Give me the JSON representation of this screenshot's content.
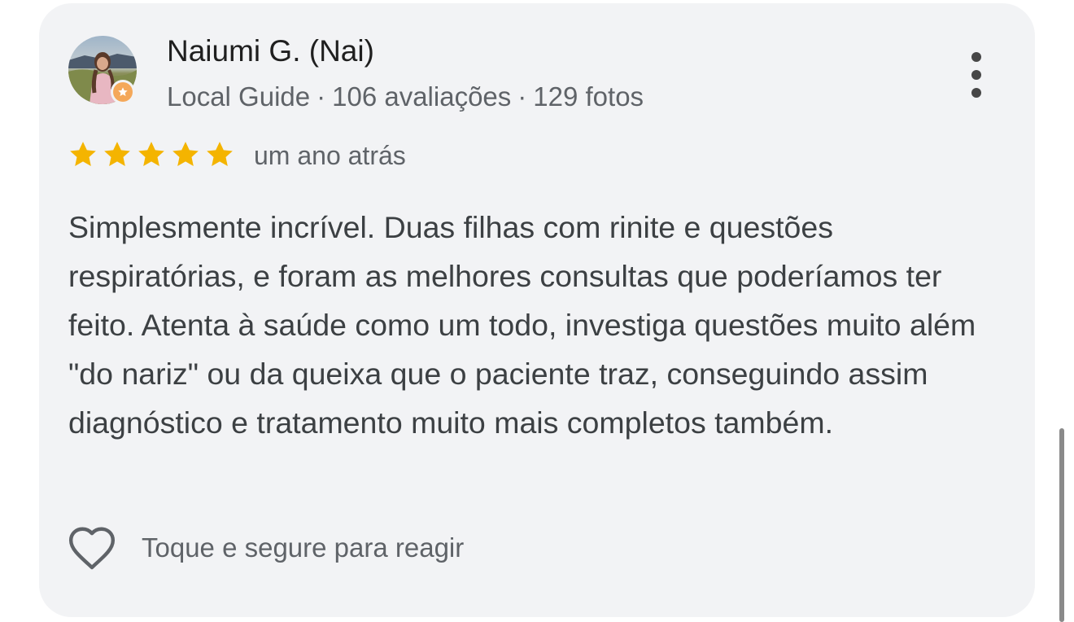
{
  "reviewer": {
    "name": "Naiumi G. (Nai)",
    "badge": "Local Guide",
    "reviews_count": "106 avaliações",
    "photos_count": "129 fotos",
    "separator": "·",
    "avatar_icon": "profile-photo",
    "badge_icon": "star-icon"
  },
  "rating": {
    "stars": 5,
    "max_stars": 5,
    "star_color": "#f4b400",
    "time_ago": "um ano atrás"
  },
  "review_text": "Simplesmente incrível. Duas filhas com rinite e questões respiratórias, e foram as melhores consultas que poderíamos ter feito. Atenta à saúde como um todo, investiga questões muito além \"do nariz\" ou da queixa que o paciente traz, conseguindo assim diagnóstico e tratamento muito mais completos também.",
  "reaction": {
    "icon": "heart-outline-icon",
    "label": "Toque e segure para reagir"
  },
  "menu": {
    "icon": "more-vert-icon"
  },
  "colors": {
    "card_background": "#f2f3f5",
    "primary_text": "#1f1f1f",
    "secondary_text": "#5f6368",
    "body_text": "#3c4043",
    "local_guide_badge": "#f4a85a"
  }
}
